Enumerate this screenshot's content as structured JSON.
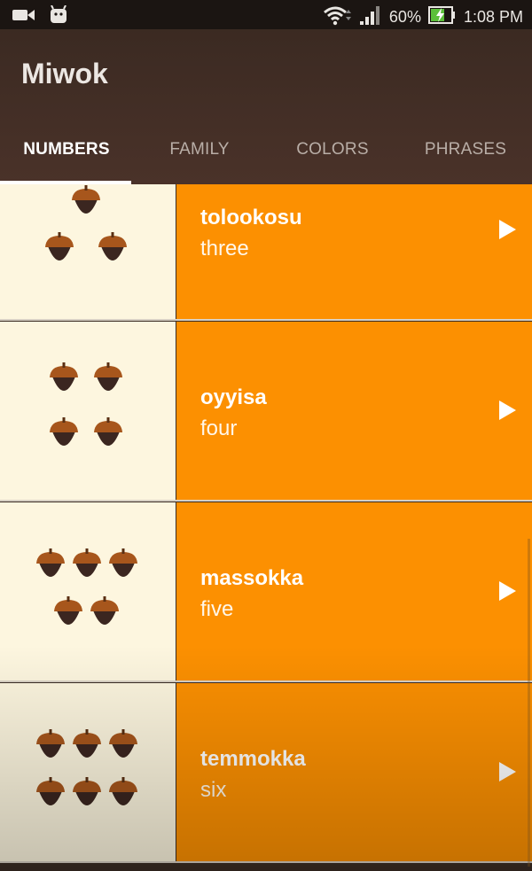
{
  "status_bar": {
    "battery": "60%",
    "time": "1:08 PM",
    "icons": [
      "video-camera-icon",
      "android-icon",
      "wifi-icon",
      "signal-icon",
      "battery-charging-icon"
    ]
  },
  "app": {
    "title": "Miwok"
  },
  "tabs": [
    {
      "label": "NUMBERS",
      "active": true
    },
    {
      "label": "FAMILY",
      "active": false
    },
    {
      "label": "COLORS",
      "active": false
    },
    {
      "label": "PHRASES",
      "active": false
    }
  ],
  "colors": {
    "accent": "#fc9001",
    "image_bg": "#fdf6df",
    "app_bar": "#3b2a22"
  },
  "words": [
    {
      "miwok": "tolookosu",
      "english": "three",
      "acorns": 3
    },
    {
      "miwok": "oyyisa",
      "english": "four",
      "acorns": 4
    },
    {
      "miwok": "massokka",
      "english": "five",
      "acorns": 5
    },
    {
      "miwok": "temmokka",
      "english": "six",
      "acorns": 6
    }
  ]
}
